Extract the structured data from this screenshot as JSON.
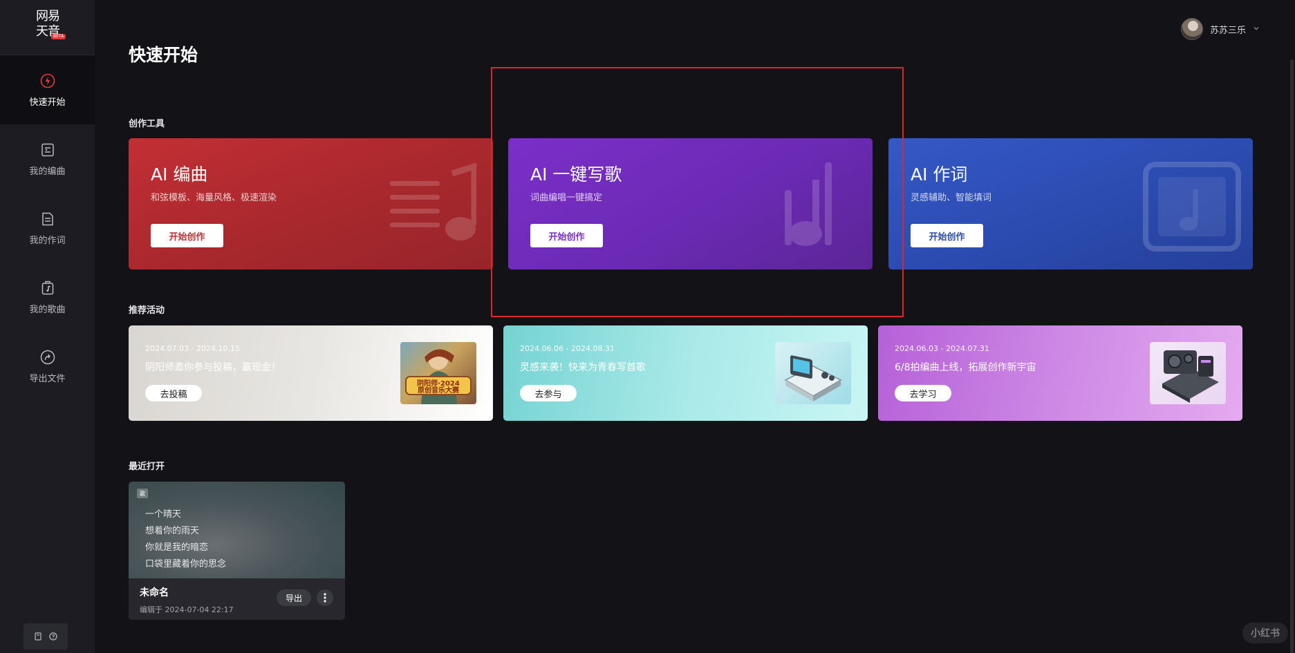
{
  "logo": {
    "line1": "网易",
    "line2": "天音",
    "badge": "BETA"
  },
  "sidebar": {
    "items": [
      {
        "label": "快速开始",
        "icon": "lightning-icon",
        "active": true
      },
      {
        "label": "我的编曲",
        "icon": "score-icon"
      },
      {
        "label": "我的作词",
        "icon": "document-icon"
      },
      {
        "label": "我的歌曲",
        "icon": "music-box-icon"
      },
      {
        "label": "导出文件",
        "icon": "export-icon"
      }
    ]
  },
  "header": {
    "title": "快速开始",
    "username": "苏苏三乐"
  },
  "sections": {
    "tools": "创作工具",
    "activities": "推荐活动",
    "recent": "最近打开"
  },
  "tools": [
    {
      "title": "AI 编曲",
      "subtitle": "和弦模板、海量风格、极速渲染",
      "button": "开始创作"
    },
    {
      "title": "AI 一键写歌",
      "subtitle": "词曲编唱一键搞定",
      "button": "开始创作"
    },
    {
      "title": "AI 作词",
      "subtitle": "灵感辅助、智能填词",
      "button": "开始创作"
    }
  ],
  "activities": [
    {
      "date": "2024.07.03 - 2024.10.15",
      "title": "阴阳师邀你参与投稿，赢现金！",
      "button": "去投稿",
      "thumb_text_1": "阴阳师·2024",
      "thumb_text_2": "原创音乐大赛"
    },
    {
      "date": "2024.06.06 - 2024.08.31",
      "title": "灵感来袭！快来为青春写首歌",
      "button": "去参与"
    },
    {
      "date": "2024.06.03 - 2024.07.31",
      "title": "6/8拍编曲上线，拓展创作新宇宙",
      "button": "去学习"
    }
  ],
  "recent": {
    "tag": "歌",
    "lyrics": [
      "一个晴天",
      "想着你的雨天",
      "你就是我的暗恋",
      "口袋里藏着你的思念"
    ],
    "name": "未命名",
    "edited": "编辑于 2024-07-04 22:17",
    "export_label": "导出"
  },
  "watermark": "小红书",
  "colors": {
    "red_card": "#c22f34",
    "purple_card": "#7b2fc9",
    "blue_card": "#2c4bb0",
    "highlight": "#e0252a"
  }
}
